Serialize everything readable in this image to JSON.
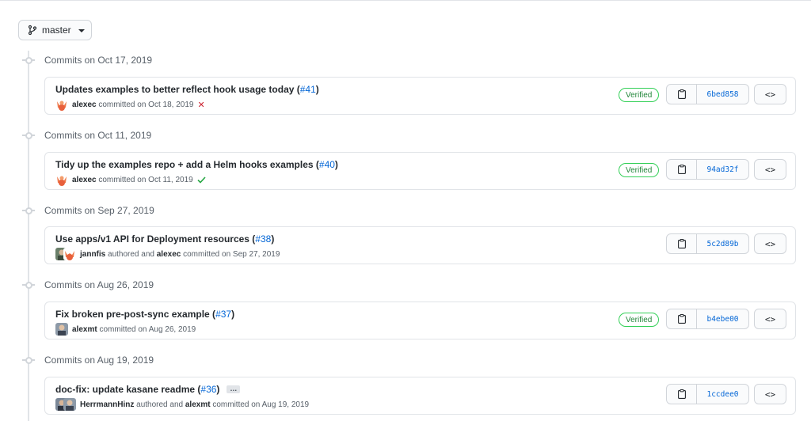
{
  "branch": {
    "name": "master",
    "icon": "git-branch-icon"
  },
  "groups": [
    {
      "header": "Commits on Oct 17, 2019",
      "commit": {
        "title": "Updates examples to better reflect hook usage today (",
        "pr": "#41",
        "title_end": ")",
        "author": "alexec",
        "action": "committed on Oct 18, 2019",
        "status": "failure",
        "status_glyph": "✕",
        "verified": "Verified",
        "sha": "6bed858",
        "browse": "<>"
      }
    },
    {
      "header": "Commits on Oct 11, 2019",
      "commit": {
        "title": "Tidy up the examples repo + add a Helm hooks examples (",
        "pr": "#40",
        "title_end": ")",
        "author": "alexec",
        "action": "committed on Oct 11, 2019",
        "status": "success",
        "verified": "Verified",
        "sha": "94ad32f",
        "browse": "<>"
      }
    },
    {
      "header": "Commits on Sep 27, 2019",
      "commit": {
        "title": "Use apps/v1 API for Deployment resources (",
        "pr": "#38",
        "title_end": ")",
        "author": "jannfis",
        "authored_text": "authored and",
        "committer": "alexec",
        "action": "committed on Sep 27, 2019",
        "sha": "5c2d89b",
        "browse": "<>"
      }
    },
    {
      "header": "Commits on Aug 26, 2019",
      "commit": {
        "title": "Fix broken pre-post-sync example (",
        "pr": "#37",
        "title_end": ")",
        "author": "alexmt",
        "action": "committed on Aug 26, 2019",
        "verified": "Verified",
        "sha": "b4ebe00",
        "browse": "<>"
      }
    },
    {
      "header": "Commits on Aug 19, 2019",
      "commit": {
        "title": "doc-fix: update kasane readme (",
        "pr": "#36",
        "title_end": ")",
        "ellipsis": "…",
        "author": "HerrmannHinz",
        "authored_text": "authored and",
        "committer": "alexmt",
        "action": "committed on Aug 19, 2019",
        "sha": "1ccdee0",
        "browse": "<>"
      }
    }
  ],
  "colors": {
    "link": "#0366d6",
    "verified": "#22863a",
    "failure": "#cb2431",
    "success": "#28a745"
  }
}
